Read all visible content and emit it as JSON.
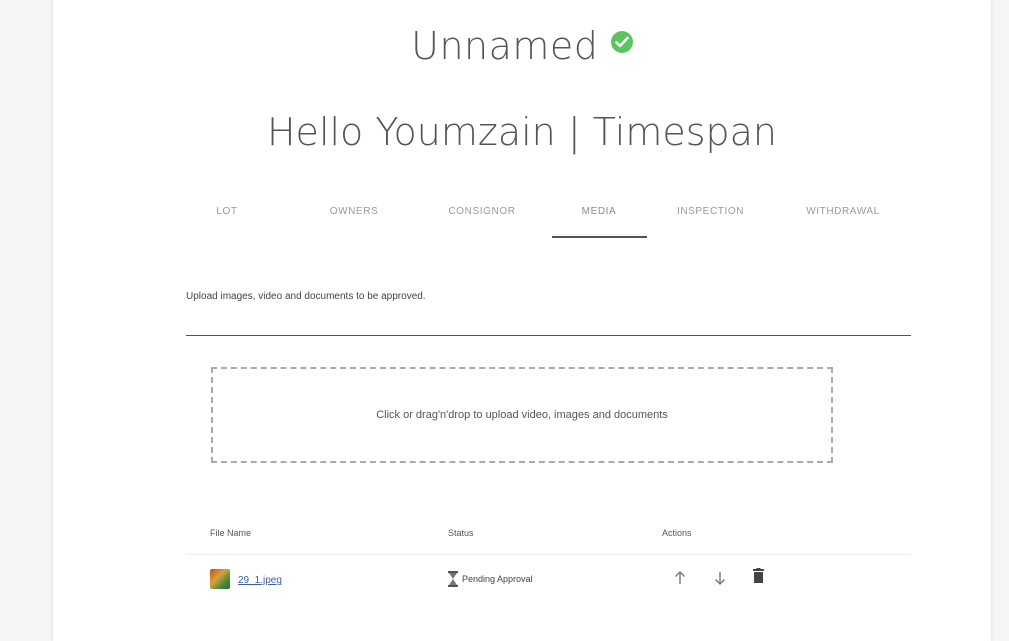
{
  "header": {
    "title": "Unnamed",
    "subtitle": "Hello Youmzain | Timespan"
  },
  "tabs": [
    {
      "label": "LOT"
    },
    {
      "label": "OWNERS"
    },
    {
      "label": "CONSIGNOR"
    },
    {
      "label": "MEDIA",
      "active": true
    },
    {
      "label": "INSPECTION"
    },
    {
      "label": "WITHDRAWAL"
    }
  ],
  "media": {
    "instructions": "Upload images, video and documents to be approved.",
    "dropzone_text": "Click or drag'n'drop to upload video, images and documents"
  },
  "table": {
    "headers": [
      "File Name",
      "Status",
      "Actions"
    ],
    "rows": [
      {
        "file_name": "29_1.jpeg",
        "status": "Pending Approval"
      }
    ]
  },
  "colors": {
    "check": "#5cc45e",
    "link": "#3a5fa8",
    "tab_active_underline": "#555555"
  },
  "icons": [
    "check-circle-icon",
    "hourglass-icon",
    "arrow-up-icon",
    "arrow-down-icon",
    "trash-icon"
  ]
}
